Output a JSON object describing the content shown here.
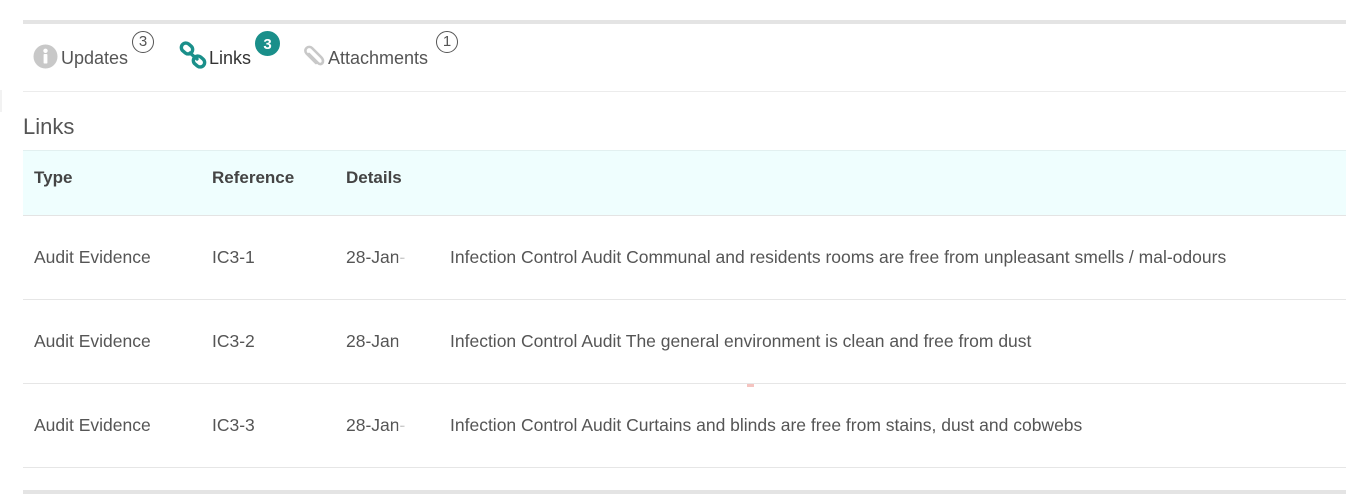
{
  "tabs": [
    {
      "label": "Updates",
      "count": "3",
      "icon": "info-circle-icon",
      "active": false
    },
    {
      "label": "Links",
      "count": "3",
      "icon": "link-chain-icon",
      "active": true
    },
    {
      "label": "Attachments",
      "count": "1",
      "icon": "paperclip-icon",
      "active": false
    }
  ],
  "section": {
    "title": "Links"
  },
  "table": {
    "headers": {
      "type": "Type",
      "reference": "Reference",
      "details": "Details"
    },
    "rows": [
      {
        "type": "Audit Evidence",
        "reference": "IC3-1",
        "date": "28-Jan-",
        "details": "Infection Control Audit Communal and residents rooms are free from unpleasant smells / mal-odours"
      },
      {
        "type": "Audit Evidence",
        "reference": "IC3-2",
        "date": "28-Jan",
        "details": "Infection Control Audit The general environment is clean and free from dust"
      },
      {
        "type": "Audit Evidence",
        "reference": "IC3-3",
        "date": "28-Jan-",
        "details": "Infection Control Audit Curtains and blinds are free from stains, dust and cobwebs"
      }
    ]
  },
  "colors": {
    "accent": "#1a8f8a",
    "header_bg": "#effefe",
    "rule": "#e4e4e4",
    "text": "#555555",
    "icon_grey": "#c8c8c8"
  }
}
